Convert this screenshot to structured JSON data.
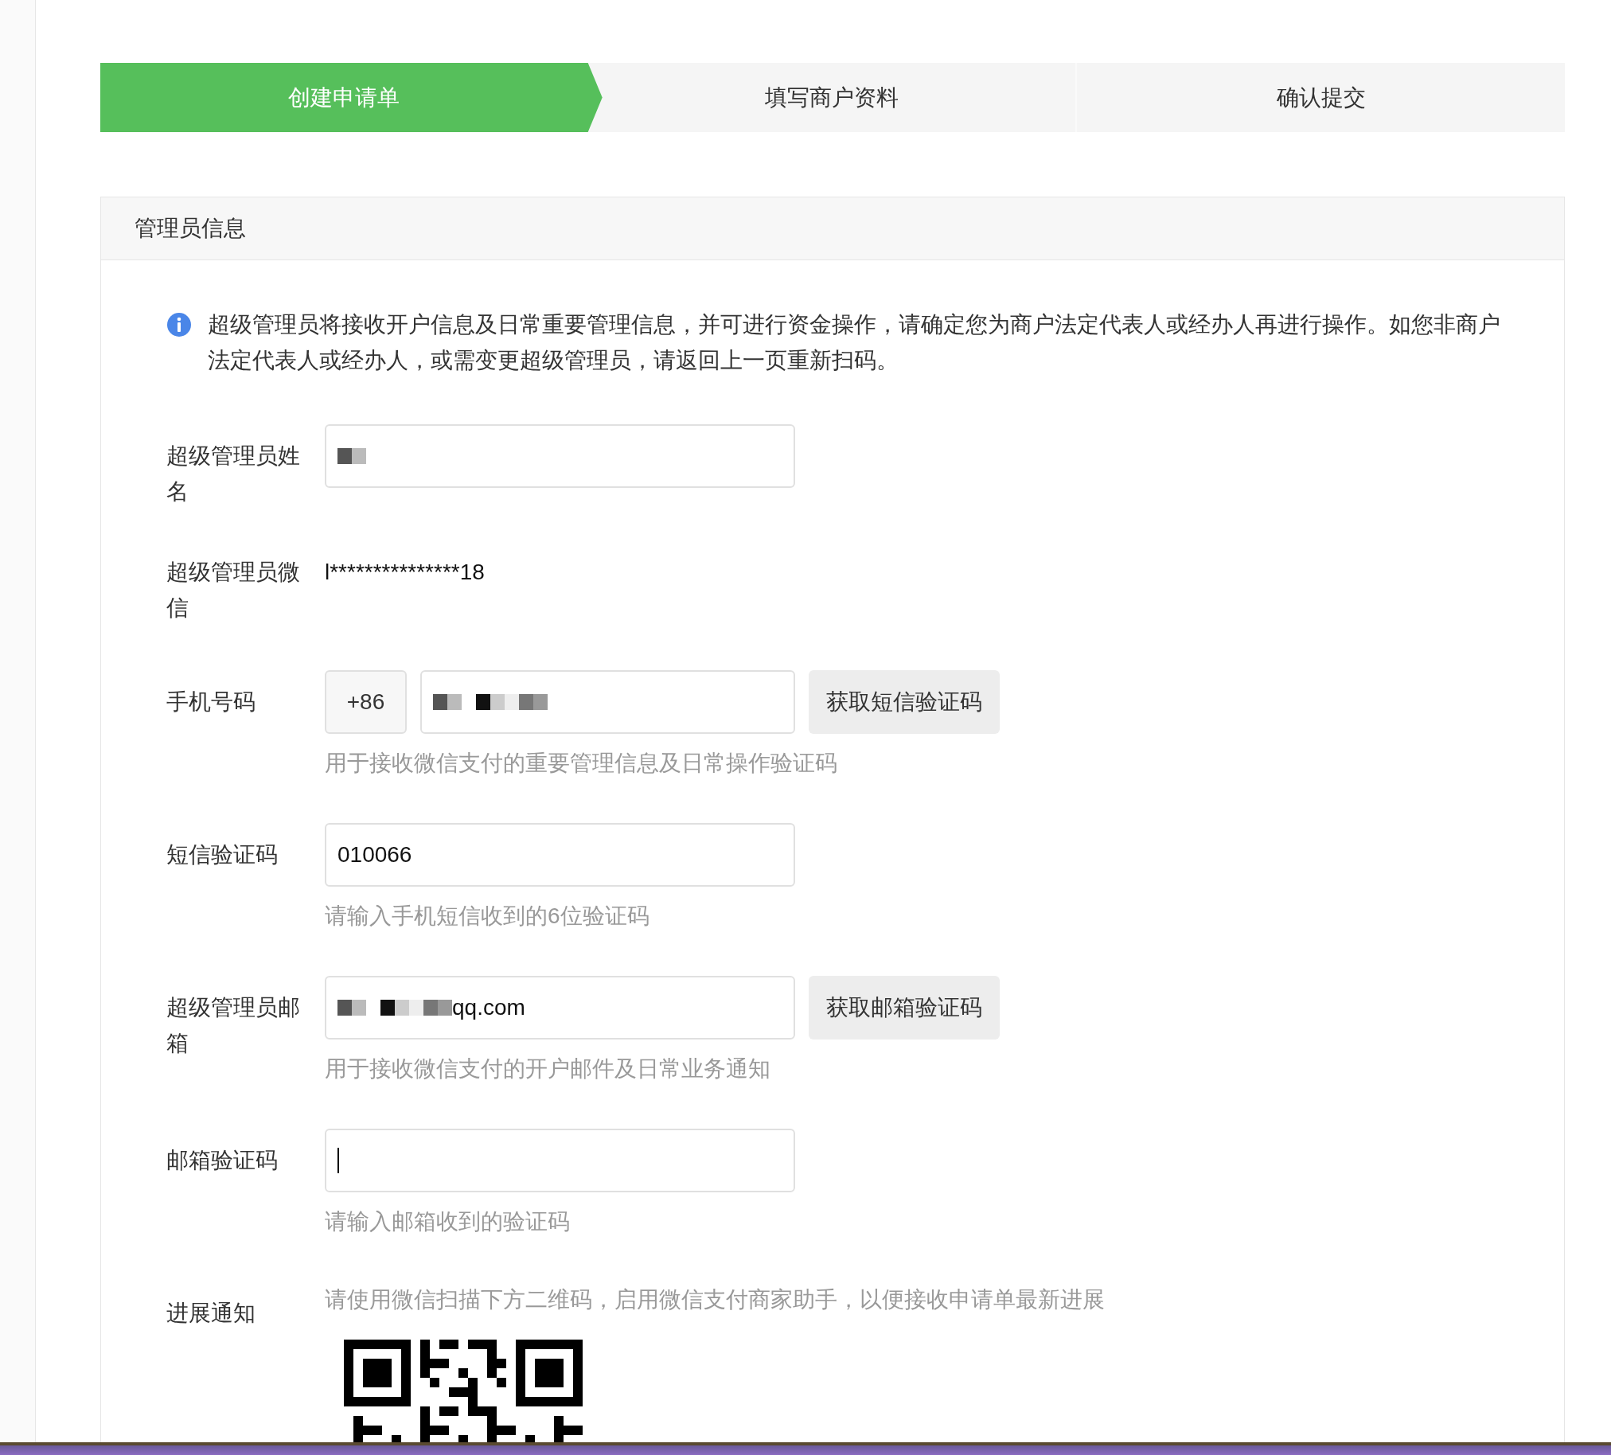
{
  "steps": [
    {
      "label": "创建申请单",
      "selected": true
    },
    {
      "label": "填写商户资料",
      "selected": false
    },
    {
      "label": "确认提交",
      "selected": false
    }
  ],
  "panel": {
    "title": "管理员信息",
    "notice": "超级管理员将接收开户信息及日常重要管理信息，并可进行资金操作，请确定您为商户法定代表人或经办人再进行操作。如您非商户法定代表人或经办人，或需变更超级管理员，请返回上一页重新扫码。",
    "fields": [
      {
        "kind": "input",
        "label": "超级管理员姓名",
        "redacted": true
      },
      {
        "kind": "text",
        "label": "超级管理员微信",
        "value": "l***************18"
      },
      {
        "kind": "phone",
        "label": "手机号码",
        "prefix": "+86",
        "redacted": true,
        "button": "获取短信验证码",
        "hint": "用于接收微信支付的重要管理信息及日常操作验证码"
      },
      {
        "kind": "input",
        "label": "短信验证码",
        "value": "010066",
        "hint": "请输入手机短信收到的6位验证码"
      },
      {
        "kind": "input",
        "label": "超级管理员邮箱",
        "redacted": true,
        "value": "qq.com",
        "button": "获取邮箱验证码",
        "hint": "用于接收微信支付的开户邮件及日常业务通知"
      },
      {
        "kind": "input",
        "label": "邮箱验证码",
        "focused": true,
        "hint": "请输入邮箱收到的验证码"
      },
      {
        "kind": "qr",
        "label": "进展通知",
        "hint": "请使用微信扫描下方二维码，启用微信支付商家助手，以便接收申请单最新进展"
      }
    ]
  }
}
